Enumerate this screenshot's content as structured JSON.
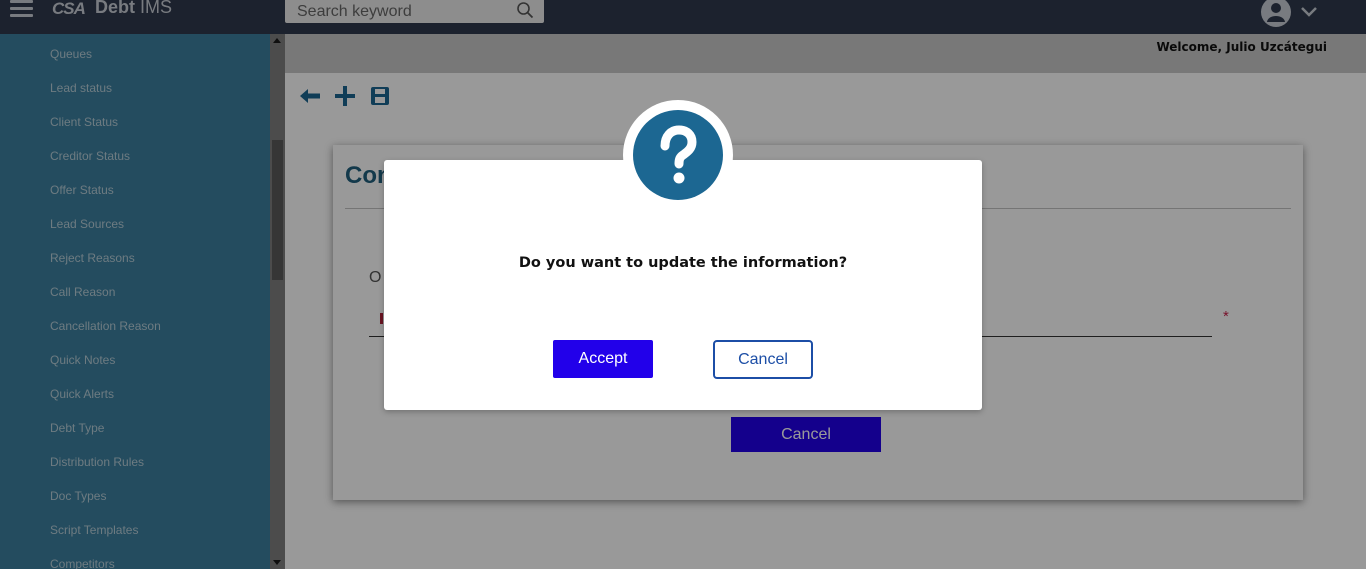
{
  "app": {
    "logo_mark": "CSA",
    "title_bold": "Debt",
    "title_rest": " IMS"
  },
  "search": {
    "placeholder": "Search keyword"
  },
  "sidebar": {
    "items": [
      {
        "label": "Queues"
      },
      {
        "label": "Lead status"
      },
      {
        "label": "Client Status"
      },
      {
        "label": "Creditor Status"
      },
      {
        "label": "Offer Status"
      },
      {
        "label": "Lead Sources"
      },
      {
        "label": "Reject Reasons"
      },
      {
        "label": "Call Reason"
      },
      {
        "label": "Cancellation Reason"
      },
      {
        "label": "Quick Notes"
      },
      {
        "label": "Quick Alerts"
      },
      {
        "label": "Debt Type"
      },
      {
        "label": "Distribution Rules"
      },
      {
        "label": "Doc Types"
      },
      {
        "label": "Script Templates"
      },
      {
        "label": "Competitors"
      }
    ]
  },
  "header": {
    "welcome": "Welcome, Julio Uzcátegui"
  },
  "toolbar": {
    "icons": [
      "back-arrow-icon",
      "add-icon",
      "save-icon"
    ]
  },
  "card": {
    "title": "Con",
    "field_label": "O",
    "required_marker": "*",
    "cancel_label": "Cancel"
  },
  "modal": {
    "icon": "question-mark-icon",
    "message": "Do you want to update the information?",
    "accept_label": "Accept",
    "cancel_label": "Cancel"
  },
  "colors": {
    "topbar": "#2f3a4d",
    "sidebar": "#3d7f9e",
    "primary_button": "#2200ea",
    "icon_blue": "#1c6792",
    "title_blue": "#20607d"
  }
}
